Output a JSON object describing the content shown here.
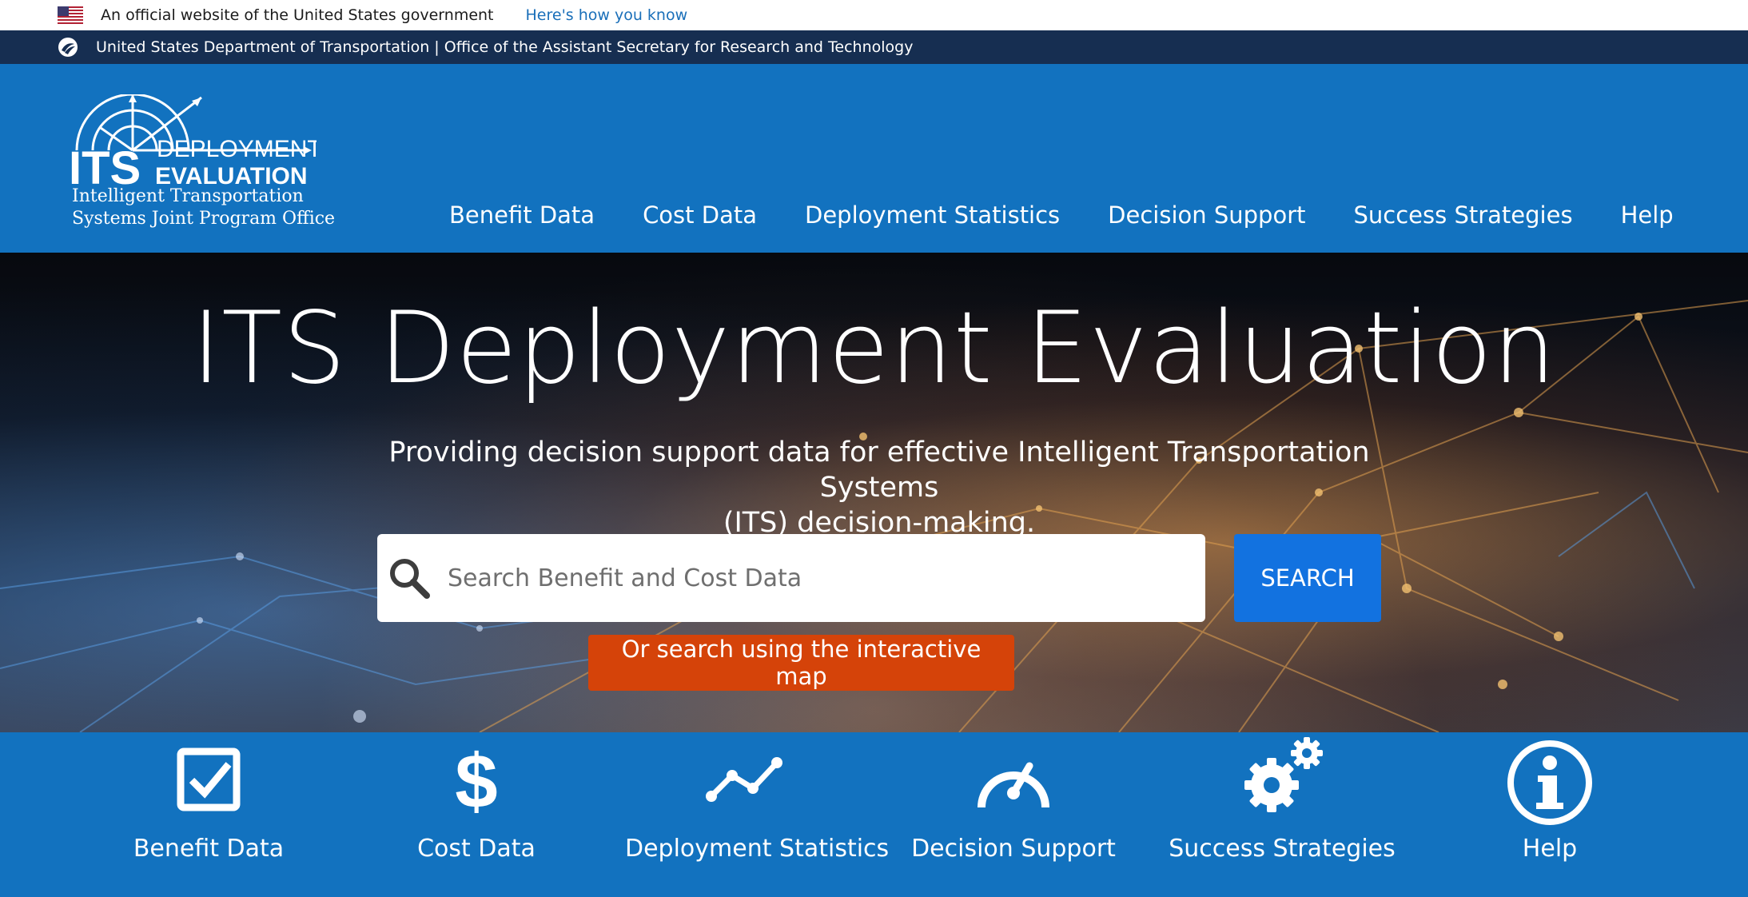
{
  "gov_banner": {
    "text": "An official website of the United States government",
    "link": "Here's how you know"
  },
  "dot_bar": {
    "text": "United States Department of Transportation | Office of the Assistant Secretary for Research and Technology"
  },
  "logo": {
    "its": "ITS",
    "deployment": "DEPLOYMENT",
    "evaluation": "EVALUATION",
    "line1": "Intelligent Transportation",
    "line2": "Systems Joint Program Office"
  },
  "nav": {
    "items": [
      {
        "label": "Benefit Data"
      },
      {
        "label": "Cost Data"
      },
      {
        "label": "Deployment Statistics"
      },
      {
        "label": "Decision Support"
      },
      {
        "label": "Success Strategies"
      },
      {
        "label": "Help"
      }
    ]
  },
  "hero": {
    "title": "ITS Deployment Evaluation",
    "subtitle_line1": "Providing decision support data for effective Intelligent Transportation Systems",
    "subtitle_line2": "(ITS) decision-making.",
    "search_placeholder": "Search Benefit and Cost Data",
    "search_button": "SEARCH",
    "map_button": "Or search using the interactive map"
  },
  "tiles": [
    {
      "label": "Benefit Data",
      "icon": "checkbox-icon"
    },
    {
      "label": "Cost Data",
      "icon": "dollar-icon"
    },
    {
      "label": "Deployment Statistics",
      "icon": "trend-line-icon"
    },
    {
      "label": "Decision Support",
      "icon": "gauge-icon"
    },
    {
      "label": "Success Strategies",
      "icon": "gears-icon"
    },
    {
      "label": "Help",
      "icon": "info-icon"
    }
  ],
  "colors": {
    "header_blue": "#1272bf",
    "dot_navy": "#162e51",
    "search_blue": "#1272e0",
    "map_orange": "#d54309"
  }
}
